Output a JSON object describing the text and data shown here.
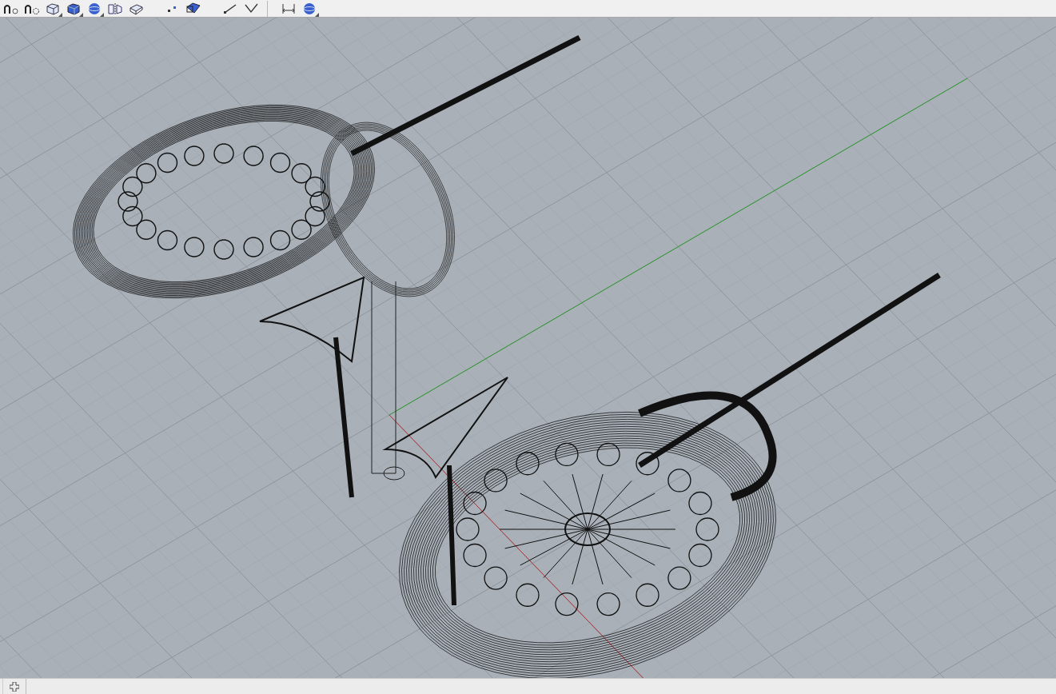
{
  "toolbar": {
    "groups": [
      {
        "buttons": [
          {
            "kind": "curve-point",
            "flyout": false
          },
          {
            "kind": "curve-gear",
            "flyout": false
          },
          {
            "kind": "box-wire",
            "flyout": true
          },
          {
            "kind": "box-solid",
            "flyout": true
          },
          {
            "kind": "sphere",
            "flyout": true
          },
          {
            "kind": "mirror",
            "flyout": false
          },
          {
            "kind": "box-tilt",
            "flyout": false
          }
        ]
      },
      {
        "buttons": [
          {
            "kind": "points",
            "flyout": false
          },
          {
            "kind": "box-flat",
            "flyout": false
          }
        ]
      },
      {
        "buttons": [
          {
            "kind": "line",
            "flyout": false
          },
          {
            "kind": "check",
            "flyout": false
          }
        ]
      },
      {
        "buttons": [
          {
            "kind": "dimension",
            "flyout": false
          },
          {
            "kind": "sphere",
            "flyout": true
          }
        ]
      }
    ]
  },
  "viewport": {
    "grid": true,
    "axes": true,
    "models": [
      {
        "kind": "ring"
      },
      {
        "kind": "pendant"
      }
    ]
  },
  "viewport_tabs": [
    {
      "kind": "add"
    }
  ]
}
